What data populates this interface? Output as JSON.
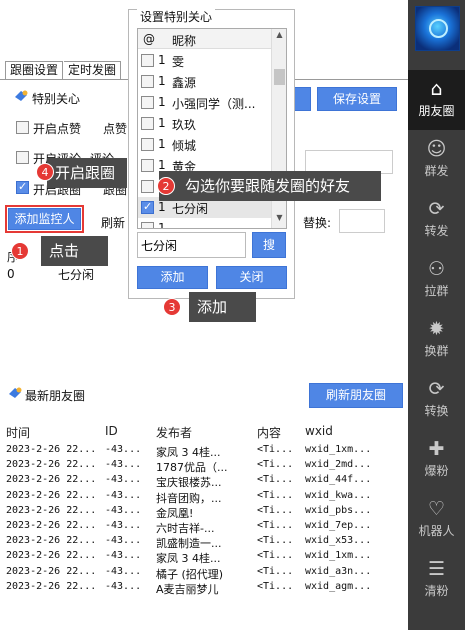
{
  "tabs": [
    "跟圈设置",
    "定时发圈"
  ],
  "special_care": {
    "title": "特别关心",
    "save_button": "保存设置",
    "options": [
      {
        "label": "开启点赞",
        "checked": false,
        "extra": "点赞"
      },
      {
        "label": "开启评论",
        "checked": false,
        "extra": "评论"
      },
      {
        "label": "开启跟圈",
        "checked": true,
        "extra": "跟圈"
      }
    ],
    "add_monitor_button": "添加监控人",
    "refresh_label": "刷新",
    "replace_label": "替换:",
    "monitor_header": "序",
    "monitor_rows": [
      {
        "index": "0",
        "name": "七分闲"
      }
    ]
  },
  "dialog": {
    "title": "设置特别关心",
    "col_at": "@",
    "col_nick": "昵称",
    "rows": [
      {
        "num": "1",
        "nick": "雯",
        "checked": false,
        "selected": false
      },
      {
        "num": "1",
        "nick": "鑫源",
        "checked": false,
        "selected": false
      },
      {
        "num": "1",
        "nick": "小强同学（测...",
        "checked": false,
        "selected": false
      },
      {
        "num": "1",
        "nick": "玖玖",
        "checked": false,
        "selected": false
      },
      {
        "num": "1",
        "nick": "倾城",
        "checked": false,
        "selected": false
      },
      {
        "num": "1",
        "nick": "黄金",
        "checked": false,
        "selected": false
      },
      {
        "num": "1",
        "nick": "黑",
        "checked": false,
        "selected": false
      },
      {
        "num": "1",
        "nick": "七分闲",
        "checked": true,
        "selected": true
      },
      {
        "num": "1",
        "nick": "",
        "checked": false,
        "selected": false
      }
    ],
    "search_value": "七分闲",
    "search_button": "搜",
    "add_button": "添加",
    "close_button": "关闭"
  },
  "callouts": [
    {
      "num": "4",
      "text": "开启跟圈"
    },
    {
      "num": "2",
      "text": "勾选你要跟随发圈的好友"
    },
    {
      "num": "1",
      "text": "点击"
    },
    {
      "num": "3",
      "text": "添加"
    }
  ],
  "moments": {
    "title": "最新朋友圈",
    "refresh_button": "刷新朋友圈",
    "headers": [
      "时间",
      "ID",
      "发布者",
      "内容",
      "wxid"
    ],
    "rows": [
      [
        "2023-2-26 22...",
        "-43...",
        "家凤 3 4桂...",
        "<Ti...",
        "wxid_1xm..."
      ],
      [
        "2023-2-26 22...",
        "-43...",
        "1787优品（...",
        "<Ti...",
        "wxid_2md..."
      ],
      [
        "2023-2-26 22...",
        "-43...",
        "宝庆银楼苏...",
        "<Ti...",
        "wxid_44f..."
      ],
      [
        "2023-2-26 22...",
        "-43...",
        "抖音团购，...",
        "<Ti...",
        "wxid_kwa..."
      ],
      [
        "2023-2-26 22...",
        "-43...",
        "金凤凰!",
        "<Ti...",
        "wxid_pbs..."
      ],
      [
        "2023-2-26 22...",
        "-43...",
        "六时吉祥-...",
        "<Ti...",
        "wxid_7ep..."
      ],
      [
        "2023-2-26 22...",
        "-43...",
        "凯盛制造一...",
        "<Ti...",
        "wxid_x53..."
      ],
      [
        "2023-2-26 22...",
        "-43...",
        "家凤 3 4桂...",
        "<Ti...",
        "wxid_1xm..."
      ],
      [
        "2023-2-26 22...",
        "-43...",
        "橘子 (招代理)",
        "<Ti...",
        "wxid_a3n..."
      ],
      [
        "2023-2-26 22...",
        "-43...",
        "A麦吉丽梦儿",
        "<Ti...",
        "wxid_agm..."
      ]
    ]
  },
  "sidebar": [
    {
      "icon": "home-icon",
      "label": "朋友圈",
      "active": true
    },
    {
      "icon": "group-send-icon",
      "label": "群发",
      "active": false
    },
    {
      "icon": "forward-icon",
      "label": "转发",
      "active": false
    },
    {
      "icon": "pull-group-icon",
      "label": "拉群",
      "active": false
    },
    {
      "icon": "switch-group-icon",
      "label": "换群",
      "active": false
    },
    {
      "icon": "convert-icon",
      "label": "转换",
      "active": false
    },
    {
      "icon": "boost-fans-icon",
      "label": "爆粉",
      "active": false
    },
    {
      "icon": "robot-icon",
      "label": "机器人",
      "active": false
    },
    {
      "icon": "clean-fans-icon",
      "label": "清粉",
      "active": false
    }
  ],
  "colors": {
    "accent": "#4f86e5",
    "sidebar": "#3b3b3b",
    "callout": "#4a4a4a",
    "badge": "#e53935",
    "highlight": "#e53935"
  }
}
